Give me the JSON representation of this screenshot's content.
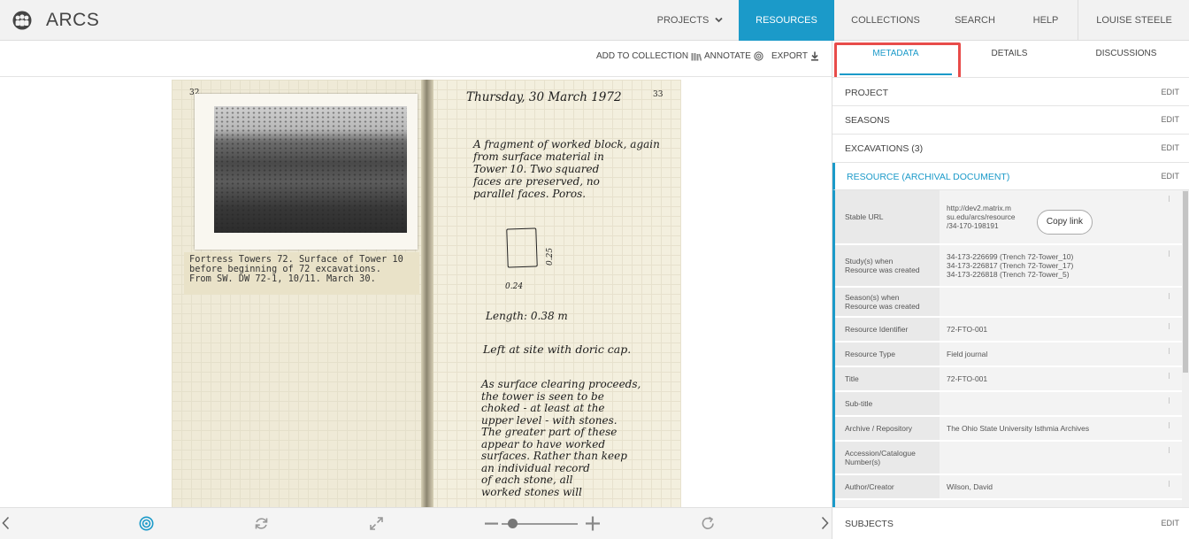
{
  "app": {
    "title": "ARCS",
    "logo_icon": "people-group-icon"
  },
  "nav": {
    "projects": "PROJECTS",
    "resources": "RESOURCES",
    "collections": "COLLECTIONS",
    "search": "SEARCH",
    "help": "HELP",
    "user": "LOUISE STEELE"
  },
  "toolbar": {
    "add_to_collection": "ADD TO COLLECTION",
    "annotate": "ANNOTATE",
    "export": "EXPORT"
  },
  "document": {
    "left_page_number": "32",
    "right_page_number": "33",
    "caption": "Fortress Towers 72. Surface of Tower 10\nbefore beginning of 72 excavations.\nFrom SW. DW 72-1, 10/11. March 30.",
    "heading": "Thursday, 30 March 1972",
    "para1": "A fragment of worked block, again\nfrom surface material in\nTower 10. Two squared\nfaces are preserved, no\nparallel faces. Poros.",
    "dim_height": "0.25",
    "dim_width": "0.24",
    "length": "Length: 0.38 m",
    "left_at_site": "Left at site with doric cap.",
    "para2": "As surface clearing proceeds,\nthe tower is seen to be\nchoked - at least at the\nupper level - with stones.\nThe greater part of these\nappear to have worked\nsurfaces. Rather than keep\nan individual record\nof each stone, all\nworked stones will"
  },
  "panel": {
    "tabs": {
      "metadata": "METADATA",
      "details": "DETAILS",
      "discussions": "DISCUSSIONS"
    },
    "edit_label": "EDIT",
    "sections": {
      "project": "PROJECT",
      "seasons": "SEASONS",
      "excavations": "EXCAVATIONS (3)",
      "resource": "RESOURCE (ARCHIVAL DOCUMENT)",
      "subjects": "SUBJECTS"
    },
    "copy_link": "Copy link",
    "metadata": [
      {
        "key": "Stable URL",
        "value": "http://dev2.matrix.m\nsu.edu/arcs/resource\n/34-170-198191"
      },
      {
        "key": "Study(s) when\nResource was created",
        "value": "34-173-226699 (Trench 72-Tower_10)\n34-173-226817 (Trench 72-Tower_17)\n34-173-226818 (Trench 72-Tower_5)"
      },
      {
        "key": "Season(s) when\nResource was created",
        "value": ""
      },
      {
        "key": "Resource Identifier",
        "value": "72-FTO-001"
      },
      {
        "key": "Resource Type",
        "value": "Field journal"
      },
      {
        "key": "Title",
        "value": "72-FTO-001"
      },
      {
        "key": "Sub-title",
        "value": ""
      },
      {
        "key": "Archive / Repository",
        "value": "The Ohio State University Isthmia Archives"
      },
      {
        "key": "Accession/Catalogue\nNumber(s)",
        "value": ""
      },
      {
        "key": "Author/Creator",
        "value": "Wilson, David"
      }
    ]
  },
  "colors": {
    "accent": "#1b9ac9",
    "highlight": "#e84c4a"
  }
}
